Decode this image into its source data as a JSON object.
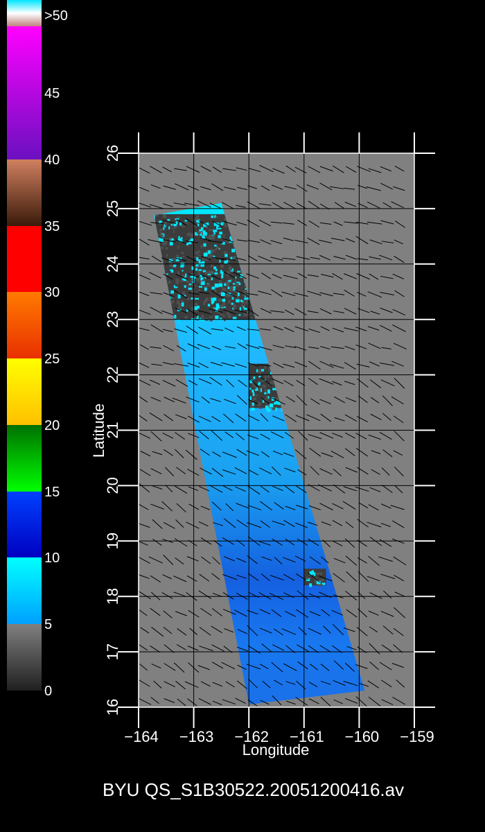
{
  "colorbar": {
    "labels": [
      ">50",
      "45",
      "40",
      "35",
      "30",
      "25",
      "20",
      "15",
      "10",
      "5",
      "0"
    ],
    "bands": [
      {
        "from": 50,
        "to": 52,
        "colors": [
          "#00e5ff",
          "#ffffff",
          "#c08080"
        ]
      },
      {
        "from": 40,
        "to": 50,
        "colors": [
          "#ff00ff",
          "#6a10c0"
        ]
      },
      {
        "from": 35,
        "to": 40,
        "colors": [
          "#d08060",
          "#3a1a0a"
        ]
      },
      {
        "from": 30,
        "to": 35,
        "colors": [
          "#ff0000",
          "#ff0000"
        ]
      },
      {
        "from": 25,
        "to": 30,
        "colors": [
          "#ff7a00",
          "#e83000"
        ]
      },
      {
        "from": 20,
        "to": 25,
        "colors": [
          "#ffff00",
          "#ffc000"
        ]
      },
      {
        "from": 15,
        "to": 20,
        "colors": [
          "#007000",
          "#00ff00"
        ]
      },
      {
        "from": 10,
        "to": 15,
        "colors": [
          "#0040ff",
          "#0000c0"
        ]
      },
      {
        "from": 5,
        "to": 10,
        "colors": [
          "#00ffff",
          "#00a0ff"
        ]
      },
      {
        "from": 0,
        "to": 5,
        "colors": [
          "#808080",
          "#202020"
        ]
      }
    ]
  },
  "chart_data": {
    "type": "heatmap",
    "title": "",
    "xlabel": "Longitude",
    "ylabel": "Latitude",
    "xlim": [
      -164,
      -159
    ],
    "ylim": [
      16,
      26
    ],
    "xticks": [
      -164,
      -163,
      -162,
      -161,
      -160,
      -159
    ],
    "yticks": [
      16,
      17,
      18,
      19,
      20,
      21,
      22,
      23,
      24,
      25,
      26
    ],
    "xtick_labels": [
      "−164",
      "−163",
      "−162",
      "−161",
      "−160",
      "−159"
    ],
    "ytick_labels": [
      "16",
      "17",
      "18",
      "19",
      "20",
      "21",
      "22",
      "23",
      "24",
      "25",
      "26"
    ],
    "grid": true,
    "background_color": "#808080",
    "swath_corners": [
      [
        -163.72,
        24.88
      ],
      [
        -162.5,
        25.1
      ],
      [
        -159.9,
        16.3
      ],
      [
        -162.0,
        16.05
      ]
    ],
    "low_speed_regions": [
      {
        "lon": [
          -163.7,
          -161.1
        ],
        "lat": [
          23.0,
          24.9
        ]
      },
      {
        "lon": [
          -162.0,
          -160.8
        ],
        "lat": [
          21.4,
          22.2
        ]
      },
      {
        "lon": [
          -161.0,
          -160.6
        ],
        "lat": [
          18.2,
          18.5
        ]
      }
    ],
    "wind_vectors": "uniform grid of short black wind direction barbs over the whole domain"
  },
  "caption": "BYU  QS_S1B30522.20051200416.av"
}
